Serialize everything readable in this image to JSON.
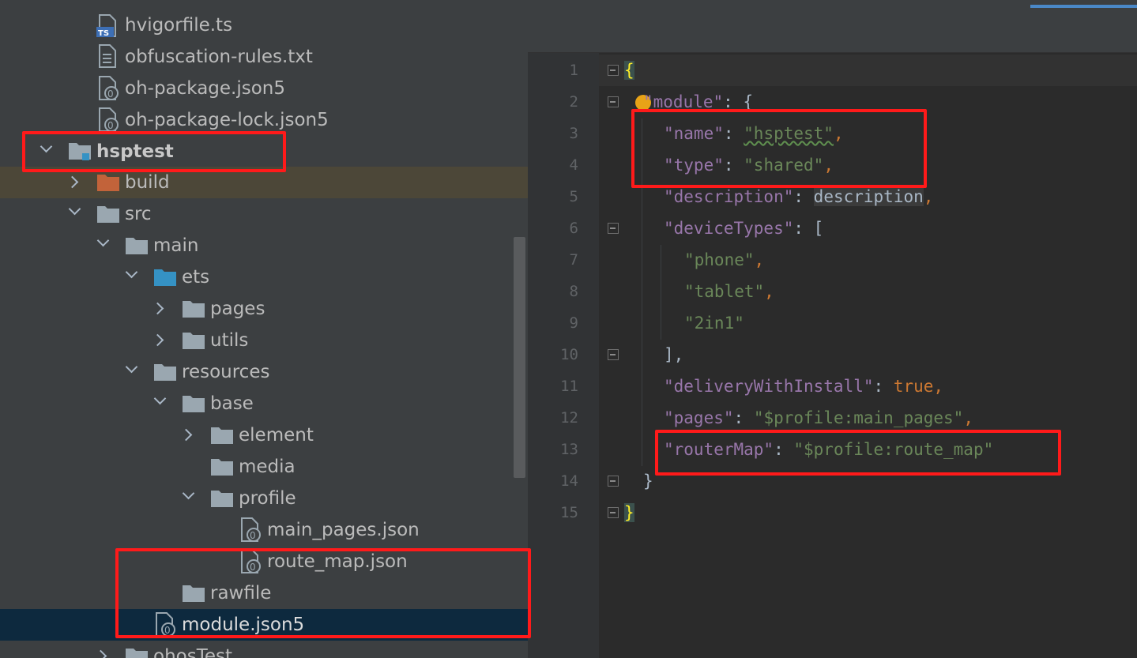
{
  "tree": {
    "items": [
      {
        "label": "hvigorfile.ts",
        "icon": "ts-file-icon"
      },
      {
        "label": "obfuscation-rules.txt",
        "icon": "text-file-icon"
      },
      {
        "label": "oh-package.json5",
        "icon": "json5-file-icon"
      },
      {
        "label": "oh-package-lock.json5",
        "icon": "json5-file-icon"
      },
      {
        "label": "hsptest",
        "icon": "module-folder-icon"
      },
      {
        "label": "build",
        "icon": "build-folder-icon"
      },
      {
        "label": "src",
        "icon": "folder-icon"
      },
      {
        "label": "main",
        "icon": "folder-icon"
      },
      {
        "label": "ets",
        "icon": "source-folder-icon"
      },
      {
        "label": "pages",
        "icon": "folder-icon"
      },
      {
        "label": "utils",
        "icon": "folder-icon"
      },
      {
        "label": "resources",
        "icon": "folder-icon"
      },
      {
        "label": "base",
        "icon": "folder-icon"
      },
      {
        "label": "element",
        "icon": "folder-icon"
      },
      {
        "label": "media",
        "icon": "folder-icon"
      },
      {
        "label": "profile",
        "icon": "folder-icon"
      },
      {
        "label": "main_pages.json",
        "icon": "json-file-icon"
      },
      {
        "label": "route_map.json",
        "icon": "json-file-icon"
      },
      {
        "label": "rawfile",
        "icon": "folder-icon"
      },
      {
        "label": "module.json5",
        "icon": "json5-file-icon"
      },
      {
        "label": "ohosTest",
        "icon": "folder-icon"
      }
    ]
  },
  "icon_text": {
    "ts": "TS"
  },
  "editor": {
    "line_numbers": [
      "1",
      "2",
      "3",
      "4",
      "5",
      "6",
      "7",
      "8",
      "9",
      "10",
      "11",
      "12",
      "13",
      "14",
      "15"
    ],
    "code": {
      "l1_brace": "{",
      "l2_key": "\"module\"",
      "l2_rest": ": {",
      "l3_key": "\"name\"",
      "l3_colon": ": ",
      "l3_val": "\"hsptest\"",
      "l3_comma": ",",
      "l4_key": "\"type\"",
      "l4_colon": ": ",
      "l4_val": "\"shared\"",
      "l4_comma": ",",
      "l5_key": "\"description\"",
      "l5_colon": ": ",
      "l5_val": "description",
      "l5_comma": ",",
      "l6_key": "\"deviceTypes\"",
      "l6_rest": ": [",
      "l7_val": "\"phone\"",
      "l7_comma": ",",
      "l8_val": "\"tablet\"",
      "l8_comma": ",",
      "l9_val": "\"2in1\"",
      "l10_close": "],",
      "l11_key": "\"deliveryWithInstall\"",
      "l11_colon": ": ",
      "l11_val": "true",
      "l11_comma": ",",
      "l12_key": "\"pages\"",
      "l12_colon": ": ",
      "l12_val": "\"$profile:main_pages\"",
      "l12_comma": ",",
      "l13_key": "\"routerMap\"",
      "l13_colon": ": ",
      "l13_val": "\"$profile:route_map\"",
      "l14_close": "}",
      "l15_brace": "}"
    }
  },
  "colors": {
    "annotation_box": "#ff1a1a",
    "json_key": "#9876aa",
    "json_string": "#6a8759",
    "keyword": "#cc7832"
  }
}
